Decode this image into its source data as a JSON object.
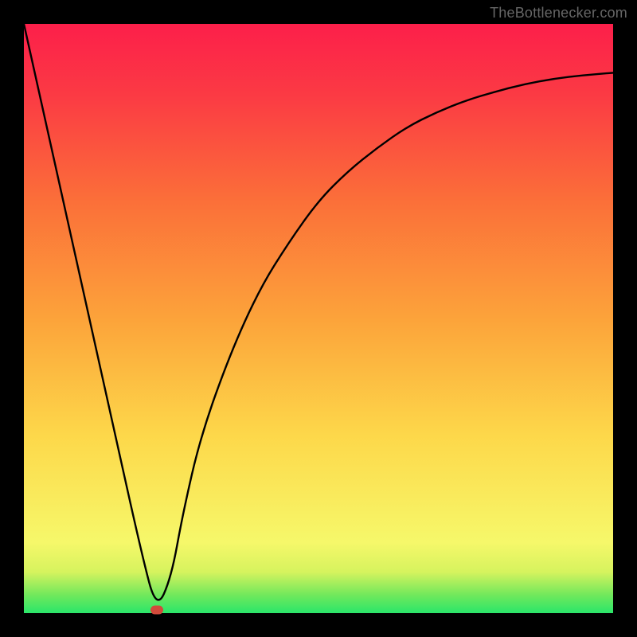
{
  "site": {
    "label": "TheBottlenecker.com"
  },
  "colors": {
    "curve": "#000000",
    "marker": "#d24a3b",
    "frame": "#000000"
  },
  "chart_data": {
    "type": "line",
    "title": "",
    "xlabel": "",
    "ylabel": "",
    "xlim": [
      0,
      100
    ],
    "ylim": [
      0,
      100
    ],
    "series": [
      {
        "name": "bottleneck-curve",
        "x": [
          0,
          5,
          10,
          15,
          20,
          22.5,
          25,
          27,
          30,
          35,
          40,
          45,
          50,
          55,
          60,
          65,
          70,
          75,
          80,
          85,
          90,
          95,
          100
        ],
        "y": [
          100,
          77.5,
          55,
          32.5,
          10,
          0.5,
          6,
          17,
          30,
          44,
          55,
          63,
          70,
          75,
          79,
          82.5,
          85,
          87,
          88.5,
          89.8,
          90.7,
          91.3,
          91.7
        ]
      }
    ],
    "markers": [
      {
        "name": "optimal-point",
        "x": 22.5,
        "y": 0.5
      }
    ],
    "gradient_stops": [
      {
        "pos": 0,
        "color": "#2ae66a"
      },
      {
        "pos": 7,
        "color": "#d6f35e"
      },
      {
        "pos": 30,
        "color": "#fdd84a"
      },
      {
        "pos": 50,
        "color": "#fca33a"
      },
      {
        "pos": 70,
        "color": "#fb6f39"
      },
      {
        "pos": 100,
        "color": "#fc1f4a"
      }
    ]
  }
}
